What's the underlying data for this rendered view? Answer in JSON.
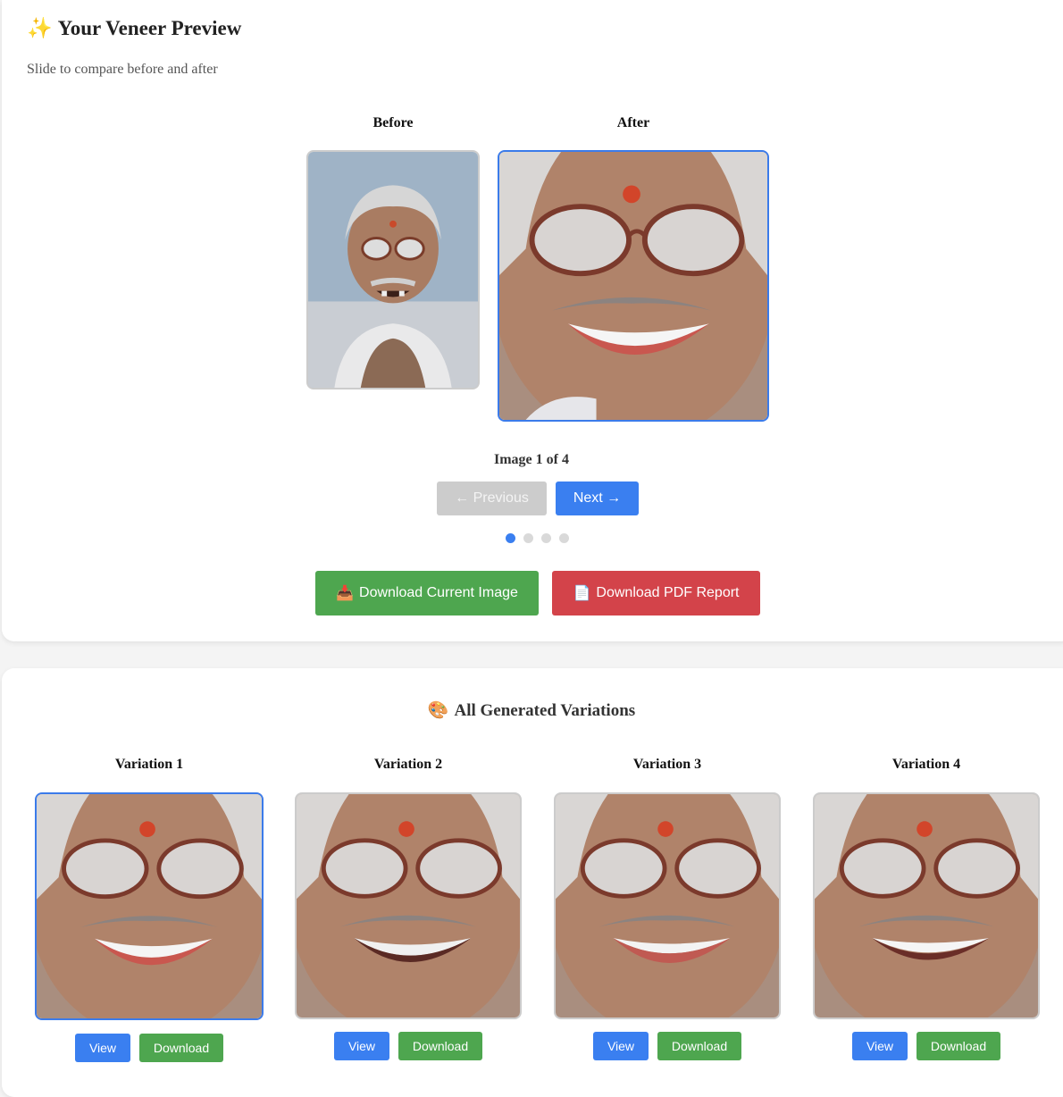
{
  "preview": {
    "title": "Your Veneer Preview",
    "title_icon": "✨",
    "subtitle": "Slide to compare before and after",
    "before_label": "Before",
    "after_label": "After",
    "counter": "Image 1 of 4",
    "prev_label": "← Previous",
    "next_label": "Next →",
    "page_count": 4,
    "active_page": 1,
    "download_image_label": "Download Current Image",
    "download_image_icon": "📥",
    "download_pdf_label": "Download PDF Report",
    "download_pdf_icon": "📄"
  },
  "variations": {
    "title": "All Generated Variations",
    "title_icon": "🎨",
    "items": [
      {
        "label": "Variation 1",
        "view": "View",
        "download": "Download",
        "selected": true
      },
      {
        "label": "Variation 2",
        "view": "View",
        "download": "Download",
        "selected": false
      },
      {
        "label": "Variation 3",
        "view": "View",
        "download": "Download",
        "selected": false
      },
      {
        "label": "Variation 4",
        "view": "View",
        "download": "Download",
        "selected": false
      }
    ]
  },
  "colors": {
    "accent": "#3a7ff0",
    "success": "#4ea64f",
    "danger": "#d3434a",
    "disabled": "#cccccc"
  }
}
